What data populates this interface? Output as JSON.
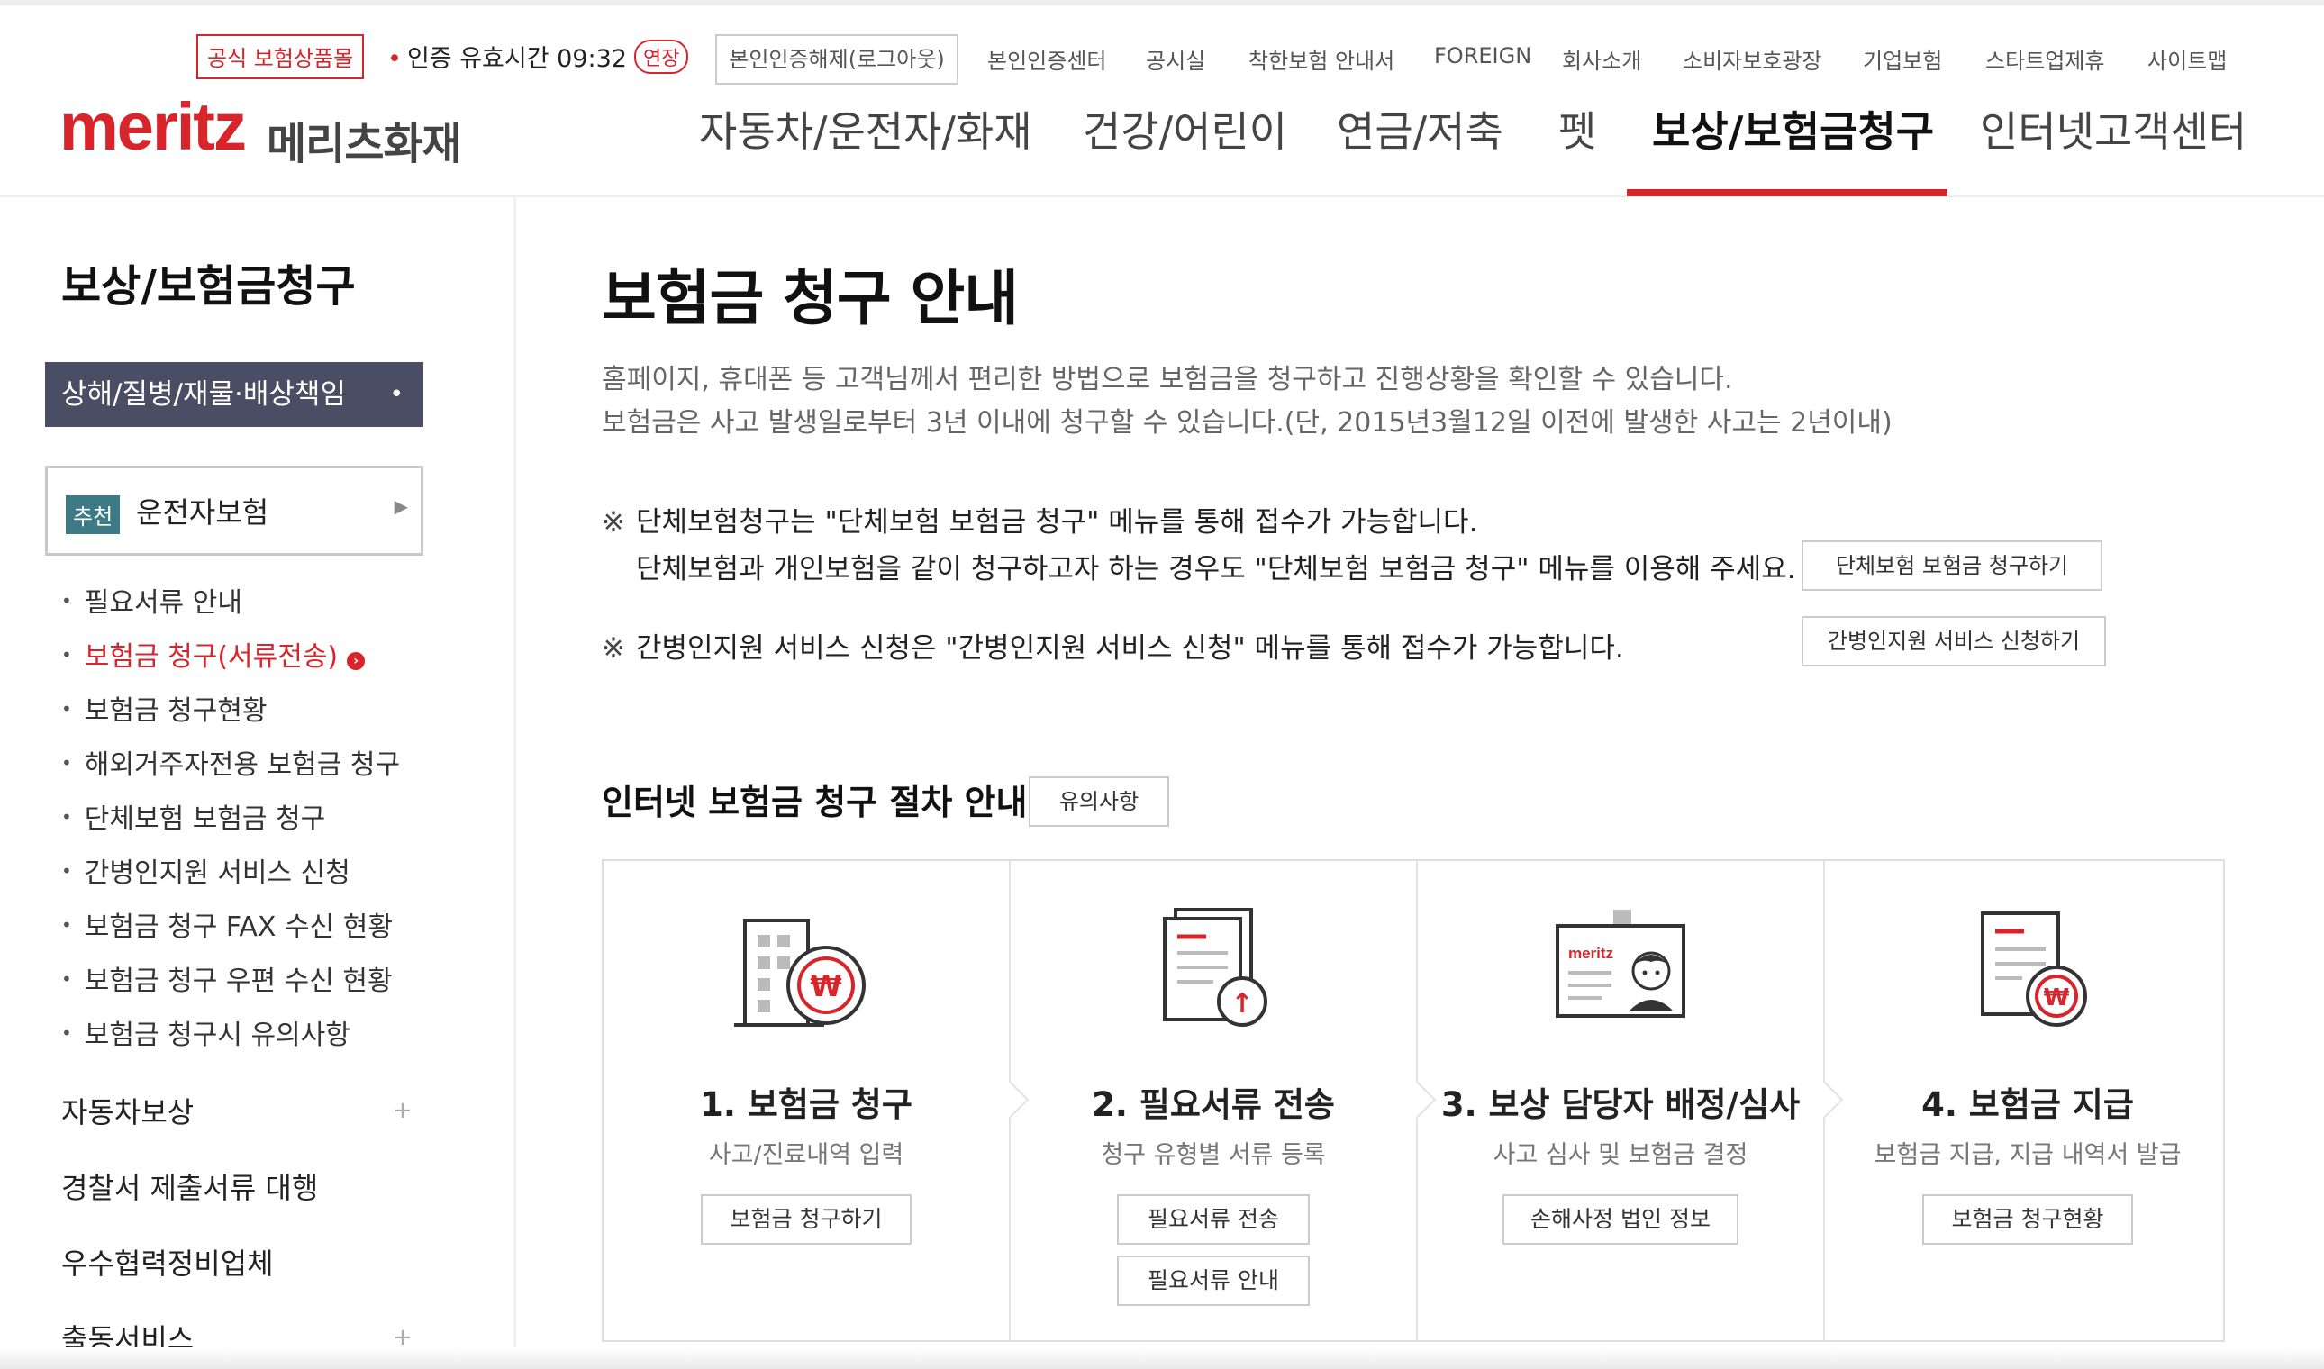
{
  "header": {
    "official_badge": "공식 보험상품몰",
    "cert_text": "인증 유효시간 09:32",
    "extend_label": "연장",
    "logout_label": "본인인증해제(로그아웃)",
    "util_links": [
      "본인인증센터",
      "공시실",
      "착한보험 안내서",
      "FOREIGN",
      "회사소개",
      "소비자보호광장",
      "기업보험",
      "스타트업제휴",
      "사이트맵"
    ],
    "logo_en": "meritz",
    "logo_ko": "메리츠화재",
    "gnb": [
      "자동차/운전자/화재",
      "건강/어린이",
      "연금/저축",
      "펫",
      "보상/보험금청구",
      "인터넷고객센터"
    ],
    "accent_color": "#d8252c"
  },
  "sidebar": {
    "title": "보상/보험금청구",
    "active_section": "상해/질병/재물·배상책임",
    "active_bullet": "•",
    "recommend_tag": "추천",
    "recommend_label": "운전자보험",
    "sub_items": [
      "필요서류 안내",
      "보험금 청구(서류전송)",
      "보험금 청구현황",
      "해외거주자전용 보험금 청구",
      "단체보험 보험금 청구",
      "간병인지원 서비스 신청",
      "보험금 청구 FAX 수신 현황",
      "보험금 청구 우편 수신 현황",
      "보험금 청구시 유의사항"
    ],
    "categories": [
      "자동차보상",
      "경찰서 제출서류 대행",
      "우수협력정비업체",
      "출동서비스"
    ]
  },
  "main": {
    "title": "보험금 청구 안내",
    "desc1": "홈페이지, 휴대폰 등 고객님께서 편리한 방법으로 보험금을 청구하고 진행상황을 확인할 수 있습니다.",
    "desc2": "보험금은 사고 발생일로부터 3년 이내에 청구할 수 있습니다.(단, 2015년3월12일 이전에 발생한 사고는 2년이내)",
    "note_mark": "※",
    "note1_line1": "단체보험청구는 \"단체보험 보험금 청구\" 메뉴를 통해 접수가 가능합니다.",
    "note1_line2": "단체보험과 개인보험을 같이 청구하고자 하는 경우도 \"단체보험 보험금 청구\" 메뉴를 이용해 주세요.",
    "note1_button": "단체보험 보험금 청구하기",
    "note2": "간병인지원 서비스 신청은 \"간병인지원 서비스 신청\" 메뉴를 통해 접수가 가능합니다.",
    "note2_button": "간병인지원 서비스 신청하기",
    "section_title": "인터넷 보험금 청구 절차 안내",
    "caution_button": "유의사항",
    "steps": [
      {
        "title": "1. 보험금 청구",
        "desc": "사고/진료내역 입력",
        "buttons": [
          "보험금 청구하기"
        ],
        "icon": "building-won-icon"
      },
      {
        "title": "2. 필요서류 전송",
        "desc": "청구 유형별 서류 등록",
        "buttons": [
          "필요서류 전송",
          "필요서류 안내"
        ],
        "icon": "document-upload-icon"
      },
      {
        "title": "3. 보상 담당자 배정/심사",
        "desc": "사고 심사 및 보험금 결정",
        "buttons": [
          "손해사정 법인 정보"
        ],
        "icon": "id-badge-icon"
      },
      {
        "title": "4. 보험금 지급",
        "desc": "보험금 지급, 지급 내역서 발급",
        "buttons": [
          "보험금 청구현황"
        ],
        "icon": "document-won-icon"
      }
    ],
    "won_symbol": "₩",
    "upload_arrow": "↑",
    "badge_brand": "meritz"
  }
}
